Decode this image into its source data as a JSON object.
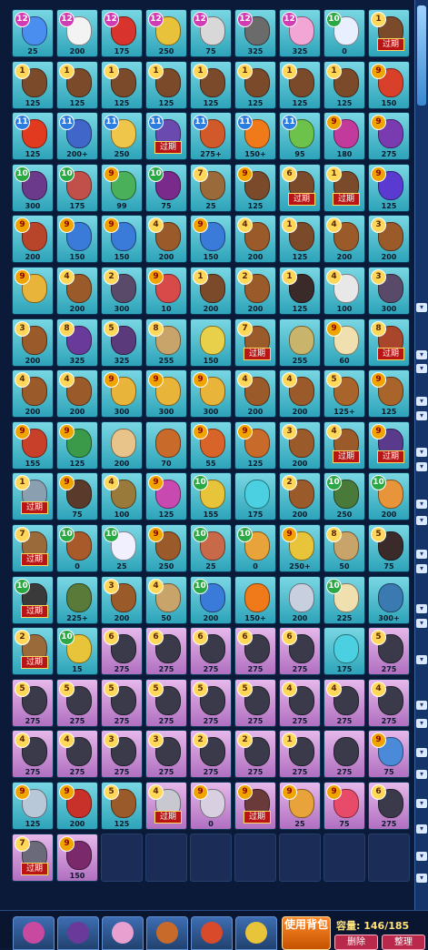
{
  "bag": {
    "use_button": "使用背包",
    "capacity_label": "容量",
    "capacity_value": "146/185",
    "expired_label": "过期",
    "delete_label": "删除",
    "organize_label": "整理"
  },
  "items": [
    {
      "lvl": "12",
      "count": "25",
      "color": "teal",
      "plant": "#4a8ff0"
    },
    {
      "lvl": "12",
      "count": "200",
      "color": "teal",
      "plant": "#f3f3f3"
    },
    {
      "lvl": "12",
      "count": "175",
      "color": "teal",
      "plant": "#d8342d"
    },
    {
      "lvl": "12",
      "count": "250",
      "color": "teal",
      "plant": "#e9c23b"
    },
    {
      "lvl": "12",
      "count": "75",
      "color": "teal",
      "plant": "#d8d8d8"
    },
    {
      "lvl": "12",
      "count": "325",
      "color": "teal",
      "plant": "#6b6b6b"
    },
    {
      "lvl": "12",
      "count": "325",
      "color": "teal",
      "plant": "#f2a6d6"
    },
    {
      "lvl": "10",
      "count": "0",
      "color": "teal",
      "plant": "#e8f0ff"
    },
    {
      "lvl": "1",
      "count": "",
      "color": "teal",
      "plant": "#7a4a2a",
      "exp": true
    },
    {
      "lvl": "1",
      "count": "125",
      "color": "teal",
      "plant": "#7a4a2a"
    },
    {
      "lvl": "1",
      "count": "125",
      "color": "teal",
      "plant": "#7a4a2a"
    },
    {
      "lvl": "1",
      "count": "125",
      "color": "teal",
      "plant": "#7a4a2a"
    },
    {
      "lvl": "1",
      "count": "125",
      "color": "teal",
      "plant": "#7a4a2a"
    },
    {
      "lvl": "1",
      "count": "125",
      "color": "teal",
      "plant": "#7a4a2a"
    },
    {
      "lvl": "1",
      "count": "125",
      "color": "teal",
      "plant": "#7a4a2a"
    },
    {
      "lvl": "1",
      "count": "125",
      "color": "teal",
      "plant": "#7a4a2a"
    },
    {
      "lvl": "1",
      "count": "125",
      "color": "teal",
      "plant": "#7a4a2a"
    },
    {
      "lvl": "9",
      "count": "150",
      "color": "teal",
      "plant": "#d8402a"
    },
    {
      "lvl": "11",
      "count": "125",
      "color": "teal",
      "plant": "#e23a1f"
    },
    {
      "lvl": "11",
      "count": "200+",
      "color": "teal",
      "plant": "#3f66c8"
    },
    {
      "lvl": "11",
      "count": "250",
      "color": "teal",
      "plant": "#f0c64a"
    },
    {
      "lvl": "11",
      "count": "",
      "color": "teal",
      "plant": "#6b4ab0",
      "exp": true
    },
    {
      "lvl": "11",
      "count": "275+",
      "color": "teal",
      "plant": "#d25a2a"
    },
    {
      "lvl": "11",
      "count": "150+",
      "color": "teal",
      "plant": "#f07a1a"
    },
    {
      "lvl": "11",
      "count": "95",
      "color": "teal",
      "plant": "#6cc24a"
    },
    {
      "lvl": "9",
      "count": "180",
      "color": "teal",
      "plant": "#c23a9b"
    },
    {
      "lvl": "9",
      "count": "275",
      "color": "teal",
      "plant": "#7a3ab0"
    },
    {
      "lvl": "10",
      "count": "300",
      "color": "teal",
      "plant": "#6b3a8a"
    },
    {
      "lvl": "10",
      "count": "175",
      "color": "teal",
      "plant": "#c2504a"
    },
    {
      "lvl": "9",
      "count": "99",
      "color": "teal",
      "plant": "#4ab05a"
    },
    {
      "lvl": "10",
      "count": "75",
      "color": "teal",
      "plant": "#7a2a8a"
    },
    {
      "lvl": "7",
      "count": "25",
      "color": "teal",
      "plant": "#9a6a3a"
    },
    {
      "lvl": "9",
      "count": "125",
      "color": "teal",
      "plant": "#7a4a2a"
    },
    {
      "lvl": "6",
      "count": "",
      "color": "teal",
      "plant": "#7a4a2a",
      "exp": true
    },
    {
      "lvl": "1",
      "count": "",
      "color": "teal",
      "plant": "#7a4a2a",
      "exp": true
    },
    {
      "lvl": "9",
      "count": "125",
      "color": "teal",
      "plant": "#5a3ad0"
    },
    {
      "lvl": "9",
      "count": "200",
      "color": "teal",
      "plant": "#b8452a"
    },
    {
      "lvl": "9",
      "count": "150",
      "color": "teal",
      "plant": "#3a7ad8"
    },
    {
      "lvl": "9",
      "count": "150",
      "color": "teal",
      "plant": "#3a7ad8"
    },
    {
      "lvl": "4",
      "count": "200",
      "color": "teal",
      "plant": "#9a5a2a"
    },
    {
      "lvl": "9",
      "count": "150",
      "color": "teal",
      "plant": "#3a7ad8"
    },
    {
      "lvl": "4",
      "count": "200",
      "color": "teal",
      "plant": "#9a5a2a"
    },
    {
      "lvl": "1",
      "count": "125",
      "color": "teal",
      "plant": "#7a4a2a"
    },
    {
      "lvl": "4",
      "count": "200",
      "color": "teal",
      "plant": "#9a5a2a"
    },
    {
      "lvl": "3",
      "count": "200",
      "color": "teal",
      "plant": "#9a5a2a"
    },
    {
      "lvl": "9",
      "count": "",
      "color": "teal",
      "plant": "#e8b43a"
    },
    {
      "lvl": "4",
      "count": "200",
      "color": "teal",
      "plant": "#9a5a2a"
    },
    {
      "lvl": "2",
      "count": "300",
      "color": "teal",
      "plant": "#5a4a6a"
    },
    {
      "lvl": "9",
      "count": "10",
      "color": "teal",
      "plant": "#d84a4a"
    },
    {
      "lvl": "1",
      "count": "200",
      "color": "teal",
      "plant": "#7a4a2a"
    },
    {
      "lvl": "2",
      "count": "200",
      "color": "teal",
      "plant": "#9a5a2a"
    },
    {
      "lvl": "1",
      "count": "125",
      "color": "teal",
      "plant": "#3a2a2a"
    },
    {
      "lvl": "4",
      "count": "100",
      "color": "teal",
      "plant": "#e8e8e8"
    },
    {
      "lvl": "3",
      "count": "300",
      "color": "teal",
      "plant": "#5a4a6a"
    },
    {
      "lvl": "3",
      "count": "200",
      "color": "teal",
      "plant": "#9a5a2a"
    },
    {
      "lvl": "8",
      "count": "325",
      "color": "teal",
      "plant": "#6a3a9a"
    },
    {
      "lvl": "5",
      "count": "325",
      "color": "teal",
      "plant": "#5a3a7a"
    },
    {
      "lvl": "8",
      "count": "255",
      "color": "teal",
      "plant": "#c8a46a"
    },
    {
      "lvl": "",
      "count": "150",
      "color": "teal",
      "plant": "#e8d04a"
    },
    {
      "lvl": "7",
      "count": "",
      "color": "teal",
      "plant": "#9a5a2a",
      "exp": true
    },
    {
      "lvl": "",
      "count": "255",
      "color": "teal",
      "plant": "#c8b46a"
    },
    {
      "lvl": "9",
      "count": "60",
      "color": "teal",
      "plant": "#f0e0b0"
    },
    {
      "lvl": "8",
      "count": "",
      "color": "teal",
      "plant": "#a8452a",
      "exp": true
    },
    {
      "lvl": "4",
      "count": "200",
      "color": "teal",
      "plant": "#9a5a2a"
    },
    {
      "lvl": "4",
      "count": "200",
      "color": "teal",
      "plant": "#9a5a2a"
    },
    {
      "lvl": "9",
      "count": "300",
      "color": "teal",
      "plant": "#e8b43a"
    },
    {
      "lvl": "9",
      "count": "300",
      "color": "teal",
      "plant": "#e8b43a"
    },
    {
      "lvl": "9",
      "count": "300",
      "color": "teal",
      "plant": "#e8b43a"
    },
    {
      "lvl": "4",
      "count": "200",
      "color": "teal",
      "plant": "#9a5a2a"
    },
    {
      "lvl": "4",
      "count": "200",
      "color": "teal",
      "plant": "#9a5a2a"
    },
    {
      "lvl": "5",
      "count": "125+",
      "color": "teal",
      "plant": "#a8642a"
    },
    {
      "lvl": "9",
      "count": "125",
      "color": "teal",
      "plant": "#a8642a"
    },
    {
      "lvl": "9",
      "count": "155",
      "color": "teal",
      "plant": "#c8402a"
    },
    {
      "lvl": "9",
      "count": "125",
      "color": "teal",
      "plant": "#3a9a4a"
    },
    {
      "lvl": "",
      "count": "200",
      "color": "teal",
      "plant": "#e8c48a"
    },
    {
      "lvl": "",
      "count": "70",
      "color": "teal",
      "plant": "#c86a2a"
    },
    {
      "lvl": "9",
      "count": "55",
      "color": "teal",
      "plant": "#d8642a"
    },
    {
      "lvl": "9",
      "count": "125",
      "color": "teal",
      "plant": "#c86a2a"
    },
    {
      "lvl": "3",
      "count": "200",
      "color": "teal",
      "plant": "#9a5a2a"
    },
    {
      "lvl": "4",
      "count": "",
      "color": "teal",
      "plant": "#9a5a2a",
      "exp": true
    },
    {
      "lvl": "9",
      "count": "",
      "color": "teal",
      "plant": "#5a3a8a",
      "exp": true
    },
    {
      "lvl": "1",
      "count": "",
      "color": "teal",
      "plant": "#8aa0b0",
      "exp": true
    },
    {
      "lvl": "9",
      "count": "75",
      "color": "teal",
      "plant": "#5a3a2a"
    },
    {
      "lvl": "4",
      "count": "100",
      "color": "teal",
      "plant": "#9a7a3a"
    },
    {
      "lvl": "9",
      "count": "125",
      "color": "teal",
      "plant": "#c84ab0"
    },
    {
      "lvl": "10",
      "count": "155",
      "color": "teal",
      "plant": "#e8c43a"
    },
    {
      "lvl": "",
      "count": "175",
      "color": "teal",
      "plant": "#4ad0e0"
    },
    {
      "lvl": "2",
      "count": "200",
      "color": "teal",
      "plant": "#9a5a2a"
    },
    {
      "lvl": "10",
      "count": "250",
      "color": "teal",
      "plant": "#4a7a3a"
    },
    {
      "lvl": "10",
      "count": "200",
      "color": "teal",
      "plant": "#e8943a"
    },
    {
      "lvl": "7",
      "count": "",
      "color": "teal",
      "plant": "#9a6a3a",
      "exp": true
    },
    {
      "lvl": "10",
      "count": "0",
      "color": "teal",
      "plant": "#a85a2a"
    },
    {
      "lvl": "10",
      "count": "25",
      "color": "teal",
      "plant": "#f0f0ff"
    },
    {
      "lvl": "9",
      "count": "250",
      "color": "teal",
      "plant": "#9a5a2a"
    },
    {
      "lvl": "10",
      "count": "25",
      "color": "teal",
      "plant": "#c86a4a"
    },
    {
      "lvl": "10",
      "count": "0",
      "color": "teal",
      "plant": "#e8a43a"
    },
    {
      "lvl": "9",
      "count": "250+",
      "color": "teal",
      "plant": "#e8c43a"
    },
    {
      "lvl": "8",
      "count": "50",
      "color": "teal",
      "plant": "#c8a46a"
    },
    {
      "lvl": "5",
      "count": "75",
      "color": "teal",
      "plant": "#3a2a2a"
    },
    {
      "lvl": "10",
      "count": "",
      "color": "teal",
      "plant": "#3a3a3a",
      "exp": true
    },
    {
      "lvl": "",
      "count": "225+",
      "color": "teal",
      "plant": "#5a7a3a"
    },
    {
      "lvl": "3",
      "count": "200",
      "color": "teal",
      "plant": "#9a5a2a"
    },
    {
      "lvl": "4",
      "count": "50",
      "color": "teal",
      "plant": "#c8a46a"
    },
    {
      "lvl": "10",
      "count": "200",
      "color": "teal",
      "plant": "#3a7ad8"
    },
    {
      "lvl": "",
      "count": "150+",
      "color": "teal",
      "plant": "#f07a1a"
    },
    {
      "lvl": "",
      "count": "200",
      "color": "teal",
      "plant": "#c8d0e0"
    },
    {
      "lvl": "10",
      "count": "225",
      "color": "teal",
      "plant": "#f0e0b0"
    },
    {
      "lvl": "",
      "count": "300+",
      "color": "teal",
      "plant": "#3a7ab0"
    },
    {
      "lvl": "2",
      "count": "",
      "color": "teal",
      "plant": "#9a6a3a",
      "exp": true
    },
    {
      "lvl": "10",
      "count": "15",
      "color": "teal",
      "plant": "#e8c43a"
    },
    {
      "lvl": "6",
      "count": "275",
      "color": "pink",
      "plant": "#3a3a4a"
    },
    {
      "lvl": "6",
      "count": "275",
      "color": "pink",
      "plant": "#3a3a4a"
    },
    {
      "lvl": "6",
      "count": "275",
      "color": "pink",
      "plant": "#3a3a4a"
    },
    {
      "lvl": "6",
      "count": "275",
      "color": "pink",
      "plant": "#3a3a4a"
    },
    {
      "lvl": "6",
      "count": "275",
      "color": "pink",
      "plant": "#3a3a4a"
    },
    {
      "lvl": "",
      "count": "175",
      "color": "teal",
      "plant": "#4ad0e0"
    },
    {
      "lvl": "5",
      "count": "275",
      "color": "pink",
      "plant": "#3a3a4a"
    },
    {
      "lvl": "5",
      "count": "275",
      "color": "pink",
      "plant": "#3a3a4a"
    },
    {
      "lvl": "5",
      "count": "275",
      "color": "pink",
      "plant": "#3a3a4a"
    },
    {
      "lvl": "5",
      "count": "275",
      "color": "pink",
      "plant": "#3a3a4a"
    },
    {
      "lvl": "5",
      "count": "275",
      "color": "pink",
      "plant": "#3a3a4a"
    },
    {
      "lvl": "5",
      "count": "275",
      "color": "pink",
      "plant": "#3a3a4a"
    },
    {
      "lvl": "5",
      "count": "275",
      "color": "pink",
      "plant": "#3a3a4a"
    },
    {
      "lvl": "4",
      "count": "275",
      "color": "pink",
      "plant": "#3a3a4a"
    },
    {
      "lvl": "4",
      "count": "275",
      "color": "pink",
      "plant": "#3a3a4a"
    },
    {
      "lvl": "4",
      "count": "275",
      "color": "pink",
      "plant": "#3a3a4a"
    },
    {
      "lvl": "4",
      "count": "275",
      "color": "pink",
      "plant": "#3a3a4a"
    },
    {
      "lvl": "4",
      "count": "275",
      "color": "pink",
      "plant": "#3a3a4a"
    },
    {
      "lvl": "3",
      "count": "275",
      "color": "pink",
      "plant": "#3a3a4a"
    },
    {
      "lvl": "3",
      "count": "275",
      "color": "pink",
      "plant": "#3a3a4a"
    },
    {
      "lvl": "2",
      "count": "275",
      "color": "pink",
      "plant": "#3a3a4a"
    },
    {
      "lvl": "2",
      "count": "275",
      "color": "pink",
      "plant": "#3a3a4a"
    },
    {
      "lvl": "1",
      "count": "275",
      "color": "pink",
      "plant": "#3a3a4a"
    },
    {
      "lvl": "",
      "count": "275",
      "color": "pink",
      "plant": "#3a3a4a"
    },
    {
      "lvl": "9",
      "count": "75",
      "color": "pink",
      "plant": "#4a8ad8"
    },
    {
      "lvl": "9",
      "count": "125",
      "color": "teal",
      "plant": "#b8c8d8"
    },
    {
      "lvl": "9",
      "count": "200",
      "color": "teal",
      "plant": "#c8302a"
    },
    {
      "lvl": "5",
      "count": "125",
      "color": "teal",
      "plant": "#9a5a2a"
    },
    {
      "lvl": "4",
      "count": "",
      "color": "pink",
      "plant": "#c8c8d0",
      "exp": true
    },
    {
      "lvl": "9",
      "count": "0",
      "color": "pink",
      "plant": "#d8d0e0"
    },
    {
      "lvl": "9",
      "count": "",
      "color": "pink",
      "plant": "#6a3a3a",
      "exp": true
    },
    {
      "lvl": "9",
      "count": "25",
      "color": "pink",
      "plant": "#e8a43a"
    },
    {
      "lvl": "9",
      "count": "75",
      "color": "pink",
      "plant": "#e84a6a"
    },
    {
      "lvl": "6",
      "count": "275",
      "color": "pink",
      "plant": "#3a3a4a"
    },
    {
      "lvl": "7",
      "count": "",
      "color": "pink",
      "plant": "#6a6a7a",
      "exp": true
    },
    {
      "lvl": "9",
      "count": "150",
      "color": "pink",
      "plant": "#7a2a6a"
    }
  ],
  "empty_slots": 7,
  "tabs": [
    {
      "name": "tab-1",
      "color": "#c84aa0"
    },
    {
      "name": "tab-2",
      "color": "#6a3a9a"
    },
    {
      "name": "tab-3",
      "color": "#e8a0d0"
    },
    {
      "name": "tab-4",
      "color": "#c86a2a"
    },
    {
      "name": "tab-5",
      "color": "#d84a2a"
    },
    {
      "name": "tab-6",
      "color": "#e8c43a"
    }
  ]
}
